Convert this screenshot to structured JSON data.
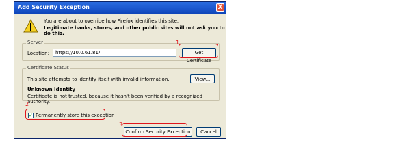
{
  "window": {
    "title": "Add Security Exception",
    "close_glyph": "X"
  },
  "intro": {
    "line1": "You are about to override how Firefox identifies this site.",
    "line2": "Legitimate banks, stores, and other public sites will not ask you to do this."
  },
  "server": {
    "group_label": "Server",
    "location_label": "Location:",
    "location_value": "https://10.0.61.81/",
    "get_certificate_label": "Get Certificate"
  },
  "status": {
    "group_label": "Certificate Status",
    "description": "This site attempts to identify itself with invalid information.",
    "view_label": "View...",
    "heading": "Unknown Identity",
    "detail": "Certificate is not trusted, because it hasn't been verified by a recognized authority."
  },
  "permanent": {
    "label": "Permanently store this exception",
    "checked": true,
    "check_glyph": "✓"
  },
  "buttons": {
    "confirm_label": "Confirm Security Exception",
    "cancel_label": "Cancel"
  },
  "annotations": {
    "n1": "1",
    "n2": "2",
    "n3": "3",
    "color": "#e0161d"
  },
  "icons": {
    "warning": "warning-icon"
  }
}
